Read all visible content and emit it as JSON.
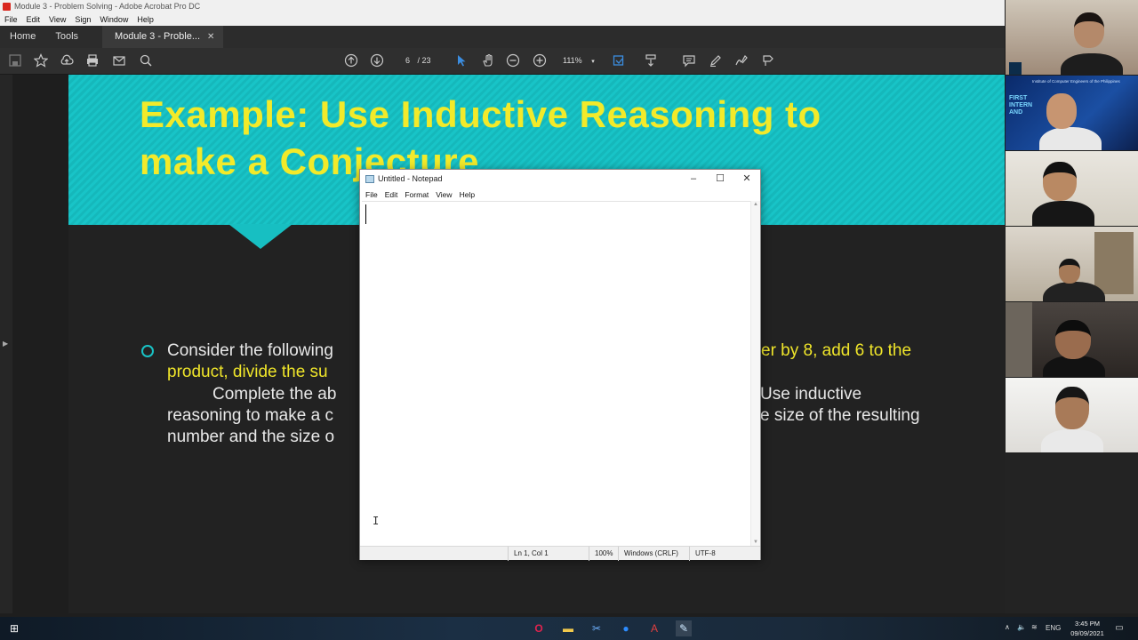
{
  "window": {
    "title": "Module 3 - Problem Solving - Adobe Acrobat Pro DC"
  },
  "menu": [
    "File",
    "Edit",
    "View",
    "Sign",
    "Window",
    "Help"
  ],
  "tabs": {
    "home": "Home",
    "tools": "Tools",
    "document": "Module 3 - Proble...",
    "close": "✕"
  },
  "toolbar": {
    "page_current": "6",
    "page_total": "/ 23",
    "zoom": "111%"
  },
  "slide": {
    "title_line1": "Example: Use Inductive Reasoning to",
    "title_line2": "make a Conjecture",
    "line1_white": "Consider the following",
    "line1_yellow": "er by 8, add 6 to the",
    "line2_yellow": "product, divide the su",
    "line3_white": "Complete the ab",
    "line3_right": "Use inductive",
    "line4_left": "reasoning to make a c",
    "line4_right": "e size of the resulting",
    "line5_left": "number and the size o"
  },
  "notepad": {
    "title": "Untitled - Notepad",
    "menu": [
      "File",
      "Edit",
      "Format",
      "View",
      "Help"
    ],
    "status": {
      "position": "Ln 1, Col 1",
      "zoom": "100%",
      "line_endings": "Windows (CRLF)",
      "encoding": "UTF-8"
    }
  },
  "video": {
    "caption": "Institute of Computer Engineers of the Philippines",
    "panel": "FIRST\nINTERN\nAND"
  },
  "taskbar": {
    "language": "ENG",
    "time": "3:45 PM",
    "date": "09/09/2021"
  },
  "colors": {
    "slide_teal": "#17bfc2",
    "slide_yellow": "#f2ea2a",
    "acrobat_red": "#d9271e"
  }
}
